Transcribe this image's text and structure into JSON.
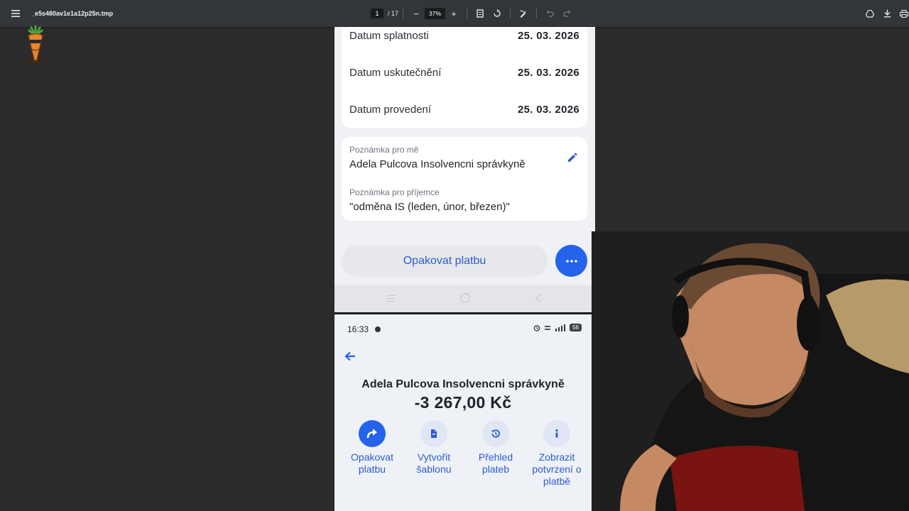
{
  "toolbar": {
    "filename": "_e5s480av1e1a12p25n.tmp",
    "page_current": "1",
    "page_total": "/ 17",
    "zoom": "37%",
    "zoom_out": "−",
    "zoom_in": "+"
  },
  "payment_detail": {
    "dates": [
      {
        "label": "Datum splatnosti",
        "value": "25. 03. 2026"
      },
      {
        "label": "Datum uskutečnění",
        "value": "25. 03. 2026"
      },
      {
        "label": "Datum provedení",
        "value": "25. 03. 2026"
      }
    ],
    "note_me_label": "Poznámka pro mě",
    "note_me_value": "Adela Pulcova Insolvencni správkyně",
    "note_recipient_label": "Poznámka pro příjemce",
    "note_recipient_value": "\"odměna IS (leden, únor, březen)\"",
    "repeat_button": "Opakovat platbu",
    "more_icon": "more-horizontal-icon"
  },
  "phone2": {
    "status": {
      "time": "16:33",
      "battery": "56"
    },
    "payee": "Adela Pulcova Insolvencni správkyně",
    "amount": "-3 267,00 Kč",
    "actions": [
      {
        "label_line1": "Opakovat",
        "label_line2": "platbu",
        "label_line3": "",
        "icon": "repeat-arrow-icon"
      },
      {
        "label_line1": "Vytvořit",
        "label_line2": "šablonu",
        "label_line3": "",
        "icon": "template-icon"
      },
      {
        "label_line1": "Přehled",
        "label_line2": "plateb",
        "label_line3": "",
        "icon": "history-icon"
      },
      {
        "label_line1": "Zobrazit",
        "label_line2": "potvrzení o",
        "label_line3": "platbě",
        "icon": "info-icon"
      }
    ]
  },
  "colors": {
    "accent": "#2463eb",
    "link": "#2e5bd3",
    "viewer_bg": "#2b2b2b",
    "toolbar_bg": "#323639"
  }
}
